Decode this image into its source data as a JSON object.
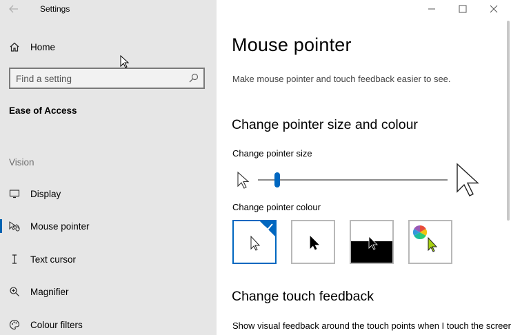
{
  "window": {
    "app_title": "Settings",
    "controls": [
      "minimize",
      "maximize",
      "close"
    ]
  },
  "sidebar": {
    "home_label": "Home",
    "search_placeholder": "Find a setting",
    "section_title": "Ease of Access",
    "group_label": "Vision",
    "items": [
      {
        "label": "Display",
        "icon": "display-icon"
      },
      {
        "label": "Mouse pointer",
        "icon": "mouse-pointer-icon",
        "active": true
      },
      {
        "label": "Text cursor",
        "icon": "text-cursor-icon"
      },
      {
        "label": "Magnifier",
        "icon": "magnifier-icon"
      },
      {
        "label": "Colour filters",
        "icon": "colour-filters-icon"
      }
    ]
  },
  "main": {
    "title": "Mouse pointer",
    "description": "Make mouse pointer and touch feedback easier to see.",
    "size_section": {
      "heading": "Change pointer size and colour",
      "size_label": "Change pointer size",
      "size_value": 1,
      "size_min": 1,
      "size_max": 15,
      "colour_label": "Change pointer colour",
      "colour_options": [
        "white",
        "black",
        "inverted",
        "custom"
      ],
      "selected_colour": "white"
    },
    "touch_section": {
      "heading": "Change touch feedback",
      "toggle_label": "Show visual feedback around the touch points when I touch the screen"
    }
  },
  "colors": {
    "accent": "#0067c0",
    "sidebar_bg": "#e6e6e6",
    "custom_pointer": "#a6d012"
  }
}
